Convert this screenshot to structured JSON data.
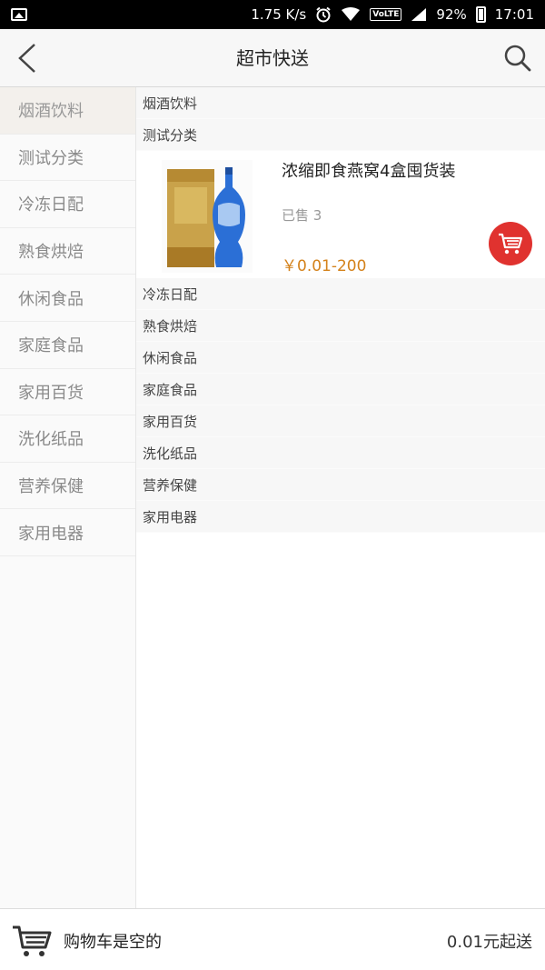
{
  "status_bar": {
    "speed": "1.75 K/s",
    "network": "VoLTE",
    "battery": "92%",
    "time": "17:01"
  },
  "header": {
    "title": "超市快送"
  },
  "sidebar": {
    "items": [
      {
        "label": "烟酒饮料"
      },
      {
        "label": "测试分类"
      },
      {
        "label": "冷冻日配"
      },
      {
        "label": "熟食烘焙"
      },
      {
        "label": "休闲食品"
      },
      {
        "label": "家庭食品"
      },
      {
        "label": "家用百货"
      },
      {
        "label": "洗化纸品"
      },
      {
        "label": "营养保健"
      },
      {
        "label": "家用电器"
      }
    ]
  },
  "main": {
    "sections": [
      {
        "label": "烟酒饮料"
      },
      {
        "label": "测试分类"
      },
      {
        "label": "冷冻日配"
      },
      {
        "label": "熟食烘焙"
      },
      {
        "label": "休闲食品"
      },
      {
        "label": "家庭食品"
      },
      {
        "label": "家用百货"
      },
      {
        "label": "洗化纸品"
      },
      {
        "label": "营养保健"
      },
      {
        "label": "家用电器"
      }
    ],
    "product": {
      "name": "浓缩即食燕窝4盒囤货装",
      "sold": "已售 3",
      "price": "￥0.01-200"
    }
  },
  "bottom_bar": {
    "cart_status": "购物车是空的",
    "min_order": "0.01元起送"
  },
  "colors": {
    "accent_price": "#d4821b",
    "cart_button": "#e0322f"
  }
}
